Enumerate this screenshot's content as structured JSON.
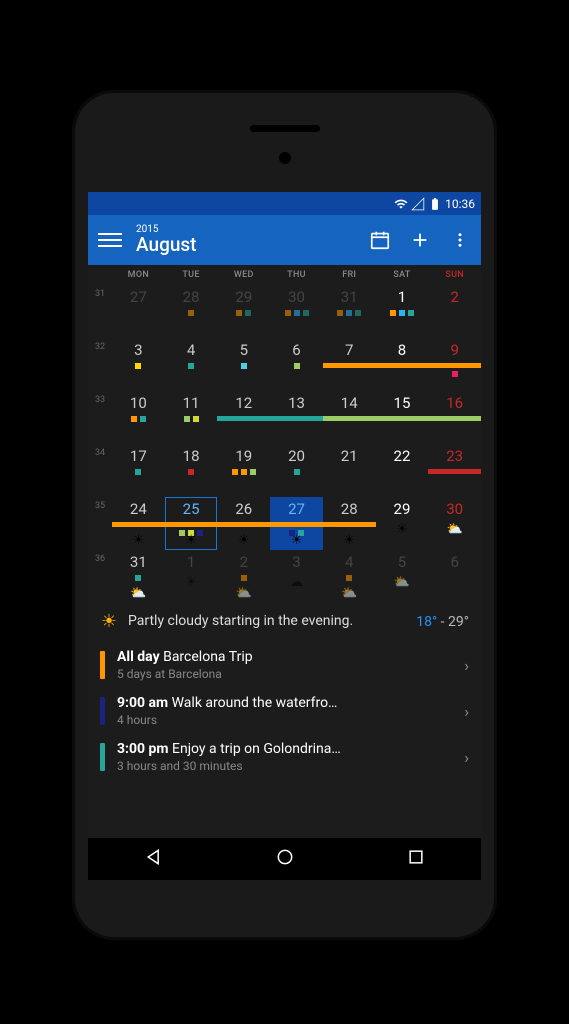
{
  "status": {
    "time": "10:36"
  },
  "appbar": {
    "year": "2015",
    "month": "August"
  },
  "dayheaders": [
    "MON",
    "TUE",
    "WED",
    "THU",
    "FRI",
    "SAT",
    "SUN"
  ],
  "weeks": [
    {
      "no": "31",
      "days": [
        {
          "n": "27",
          "cls": "prev",
          "dots": []
        },
        {
          "n": "28",
          "cls": "prev",
          "dots": [
            "c-orange"
          ]
        },
        {
          "n": "29",
          "cls": "prev",
          "dots": [
            "c-orange",
            "c-teal"
          ]
        },
        {
          "n": "30",
          "cls": "prev",
          "dots": [
            "c-orange",
            "c-lb",
            "c-teal"
          ]
        },
        {
          "n": "31",
          "cls": "prev",
          "dots": [
            "c-orange",
            "c-lb",
            "c-teal"
          ]
        },
        {
          "n": "1",
          "cls": "sat",
          "dots": [
            "c-orange",
            "c-lb",
            "c-teal"
          ]
        },
        {
          "n": "2",
          "cls": "sun",
          "dots": []
        }
      ]
    },
    {
      "no": "32",
      "days": [
        {
          "n": "3",
          "dots": [
            "c-yellow"
          ]
        },
        {
          "n": "4",
          "dots": [
            "c-teal"
          ]
        },
        {
          "n": "5",
          "dots": [
            "c-cyan"
          ]
        },
        {
          "n": "6",
          "dots": [
            "c-green"
          ]
        },
        {
          "n": "7",
          "bars": [
            {
              "c": "c-orange",
              "p": 1
            }
          ]
        },
        {
          "n": "8",
          "cls": "sat",
          "bars": [
            {
              "c": "c-orange",
              "p": 1
            }
          ]
        },
        {
          "n": "9",
          "cls": "sun",
          "bars": [
            {
              "c": "c-orange",
              "p": 1
            }
          ],
          "dots": [
            "c-pink"
          ]
        }
      ]
    },
    {
      "no": "33",
      "days": [
        {
          "n": "10",
          "dots": [
            "c-orange",
            "c-teal"
          ]
        },
        {
          "n": "11",
          "dots": [
            "c-green",
            "c-lime"
          ]
        },
        {
          "n": "12",
          "bars": [
            {
              "c": "c-teal",
              "p": 1
            }
          ]
        },
        {
          "n": "13",
          "bars": [
            {
              "c": "c-teal",
              "p": 1
            }
          ]
        },
        {
          "n": "14",
          "bars": [
            {
              "c": "c-green",
              "p": 1
            }
          ]
        },
        {
          "n": "15",
          "cls": "sat",
          "bars": [
            {
              "c": "c-green",
              "p": 1
            }
          ]
        },
        {
          "n": "16",
          "cls": "sun",
          "bars": [
            {
              "c": "c-green",
              "p": 1
            }
          ]
        }
      ]
    },
    {
      "no": "34",
      "days": [
        {
          "n": "17",
          "dots": [
            "c-teal"
          ]
        },
        {
          "n": "18",
          "dots": [
            "c-red"
          ]
        },
        {
          "n": "19",
          "dots": [
            "c-orange",
            "c-orange",
            "c-green"
          ]
        },
        {
          "n": "20",
          "dots": [
            "c-teal"
          ]
        },
        {
          "n": "21",
          "dots": []
        },
        {
          "n": "22",
          "cls": "sat",
          "dots": []
        },
        {
          "n": "23",
          "cls": "sun",
          "bars": [
            {
              "c": "c-red",
              "p": 1
            }
          ]
        }
      ]
    },
    {
      "no": "35",
      "days": [
        {
          "n": "24",
          "bars": [
            {
              "c": "c-orange",
              "p": 1
            }
          ],
          "wx": "☀"
        },
        {
          "n": "25",
          "cls": "today",
          "bars": [
            {
              "c": "c-orange",
              "p": 1
            }
          ],
          "dots": [
            "c-green",
            "c-lime",
            "c-blue"
          ],
          "wx": "☀"
        },
        {
          "n": "26",
          "bars": [
            {
              "c": "c-orange",
              "p": 1
            }
          ],
          "wx": "☀"
        },
        {
          "n": "27",
          "cls": "sel",
          "bars": [
            {
              "c": "c-orange",
              "p": 1
            }
          ],
          "dots": [
            "c-blue",
            "c-teal"
          ],
          "wx": "☀"
        },
        {
          "n": "28",
          "bars": [
            {
              "c": "c-orange",
              "p": 1
            }
          ],
          "wx": "☀"
        },
        {
          "n": "29",
          "cls": "sat",
          "wx": "☀"
        },
        {
          "n": "30",
          "cls": "sun",
          "wx": "⛅"
        }
      ]
    },
    {
      "no": "36",
      "days": [
        {
          "n": "31",
          "dots": [
            "c-teal"
          ],
          "wx": "⛅"
        },
        {
          "n": "1",
          "cls": "prev",
          "wx": "☀"
        },
        {
          "n": "2",
          "cls": "prev",
          "dots": [
            "c-orange"
          ],
          "wx": "⛅"
        },
        {
          "n": "3",
          "cls": "prev",
          "wx": "☁"
        },
        {
          "n": "4",
          "cls": "prev",
          "dots": [
            "c-orange"
          ],
          "wx": "⛅"
        },
        {
          "n": "5",
          "cls": "prev sat",
          "wx": "⛅"
        },
        {
          "n": "6",
          "cls": "prev sun",
          "wx": ""
        }
      ]
    }
  ],
  "weather": {
    "text": "Partly cloudy starting in the evening.",
    "lo": "18°",
    "hi": "29°",
    "sep": " - "
  },
  "events": [
    {
      "color": "c-orange",
      "time": "All day",
      "title": " Barcelona Trip",
      "sub": "5 days at Barcelona"
    },
    {
      "color": "c-blue",
      "time": "9:00 am",
      "title": " Walk around the waterfro…",
      "sub": "4 hours"
    },
    {
      "color": "c-teal",
      "time": "3:00 pm",
      "title": " Enjoy a trip on Golondrina…",
      "sub": "3 hours and 30 minutes"
    }
  ]
}
